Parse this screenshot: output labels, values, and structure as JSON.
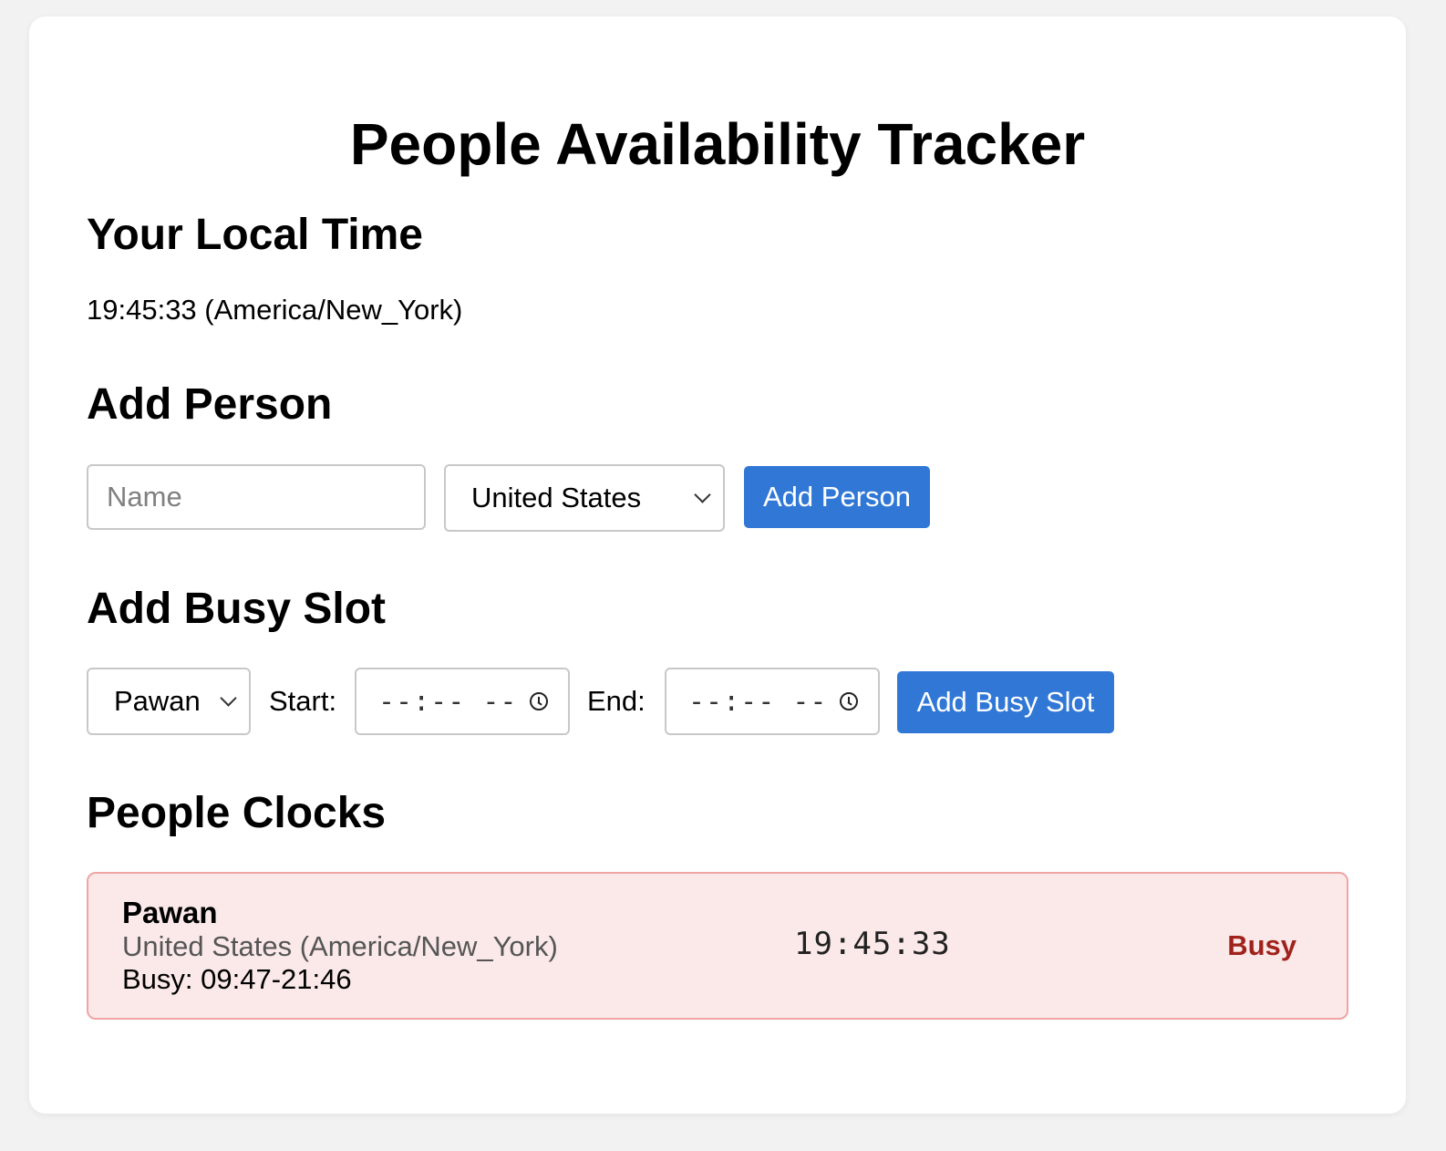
{
  "app": {
    "title": "People Availability Tracker"
  },
  "local_time": {
    "heading": "Your Local Time",
    "value": "19:45:33 (America/New_York)"
  },
  "add_person": {
    "heading": "Add Person",
    "name_placeholder": "Name",
    "name_value": "",
    "country_selected": "United States",
    "button_label": "Add Person"
  },
  "add_busy_slot": {
    "heading": "Add Busy Slot",
    "person_selected": "Pawan",
    "start_label": "Start:",
    "start_placeholder": "--:-- --",
    "end_label": "End:",
    "end_placeholder": "--:-- --",
    "button_label": "Add Busy Slot"
  },
  "people_clocks": {
    "heading": "People Clocks",
    "people": [
      {
        "name": "Pawan",
        "location": "United States (America/New_York)",
        "busy_text": "Busy: 09:47-21:46",
        "clock": "19:45:33",
        "status": "Busy"
      }
    ]
  },
  "colors": {
    "accent": "#3178d6",
    "busy_status": "#a0221c",
    "busy_card_bg": "#fbe9e9",
    "busy_card_border": "#f0a4a4"
  }
}
